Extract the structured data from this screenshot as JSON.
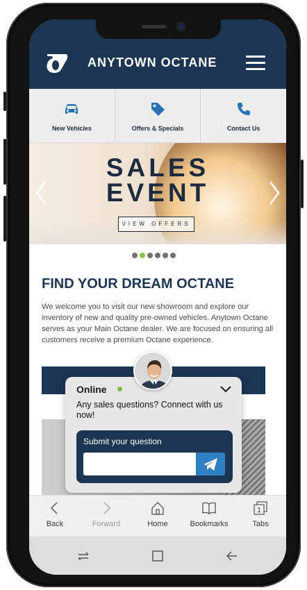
{
  "header": {
    "brand": "ANYTOWN OCTANE"
  },
  "quicknav": [
    {
      "label": "New Vehicles",
      "icon": "car-icon"
    },
    {
      "label": "Offers & Specials",
      "icon": "tag-icon"
    },
    {
      "label": "Contact Us",
      "icon": "phone-icon"
    }
  ],
  "banner": {
    "title_line1": "SALES",
    "title_line2": "EVENT",
    "button": "VIEW OFFERS",
    "slide_count": 6,
    "active_slide": 2
  },
  "main": {
    "headline": "FIND YOUR DREAM OCTANE",
    "paragraph": "We welcome you to visit our new showroom and explore our inventory of new and quality pre-owned vehicles. Anytown Octane serves as your Main Octane dealer. We are focused on ensuring all customers receive a premium Octane experience."
  },
  "chat": {
    "status": "Online",
    "message": "Any sales questions? Connect with us now!",
    "form_label": "Submit your question",
    "input_value": "",
    "status_color": "#7cc242"
  },
  "browser": {
    "back": "Back",
    "forward": "Forward",
    "home": "Home",
    "bookmarks": "Bookmarks",
    "tabs": "Tabs",
    "tab_count": "1"
  },
  "colors": {
    "brand_navy": "#1c3553",
    "accent_blue": "#2f7fc3"
  }
}
